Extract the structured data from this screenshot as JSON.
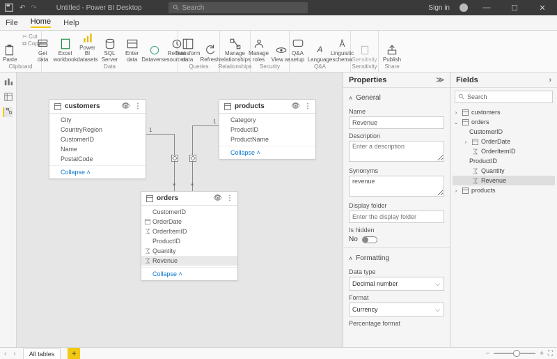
{
  "titlebar": {
    "title": "Untitled - Power BI Desktop",
    "search_placeholder": "Search",
    "sign_in": "Sign in"
  },
  "menu": {
    "file": "File",
    "home": "Home",
    "help": "Help"
  },
  "ribbon": {
    "clipboard_label": "Clipboard",
    "paste": "Paste",
    "cut": "Cut",
    "copy": "Copy",
    "data_label": "Data",
    "get_data": "Get data",
    "excel": "Excel workbook",
    "pbi": "Power BI datasets",
    "sql": "SQL Server",
    "enter": "Enter data",
    "dataverse": "Dataverse",
    "recent": "Recent sources",
    "queries_label": "Queries",
    "transform": "Transform data",
    "refresh": "Refresh",
    "rel_label": "Relationships",
    "manage_rel": "Manage relationships",
    "security_label": "Security",
    "manage_roles": "Manage roles",
    "view_as": "View as",
    "qa_label": "Q&A",
    "qa_setup": "Q&A setup",
    "language": "Language",
    "ling": "Linguistic schema",
    "sens_label": "Sensitivity",
    "sens": "Sensitivity",
    "share_label": "Share",
    "publish": "Publish"
  },
  "tables": {
    "customers": {
      "title": "customers",
      "collapse": "Collapse",
      "fields": [
        "City",
        "CountryRegion",
        "CustomerID",
        "Name",
        "PostalCode"
      ]
    },
    "products": {
      "title": "products",
      "collapse": "Collapse",
      "fields": [
        "Category",
        "ProductID",
        "ProductName"
      ]
    },
    "orders": {
      "title": "orders",
      "collapse": "Collapse",
      "fields": [
        "CustomerID",
        "OrderDate",
        "OrderItemID",
        "ProductID",
        "Quantity",
        "Revenue"
      ]
    }
  },
  "rel": {
    "one": "1",
    "many": "*"
  },
  "tabs": {
    "all": "All tables"
  },
  "properties": {
    "pane_title": "Properties",
    "general": "General",
    "name_label": "Name",
    "name_value": "Revenue",
    "desc_label": "Description",
    "desc_placeholder": "Enter a description",
    "syn_label": "Synonyms",
    "syn_value": "revenue",
    "folder_label": "Display folder",
    "folder_placeholder": "Enter the display folder",
    "hidden_label": "Is hidden",
    "hidden_no": "No",
    "formatting": "Formatting",
    "dtype_label": "Data type",
    "dtype_value": "Decimal number",
    "format_label": "Format",
    "format_value": "Currency",
    "pct_label": "Percentage format"
  },
  "fields": {
    "pane_title": "Fields",
    "search_placeholder": "Search",
    "customers": "customers",
    "orders": "orders",
    "order_fields": [
      "CustomerID",
      "OrderDate",
      "OrderItemID",
      "ProductID",
      "Quantity",
      "Revenue"
    ],
    "products": "products"
  }
}
